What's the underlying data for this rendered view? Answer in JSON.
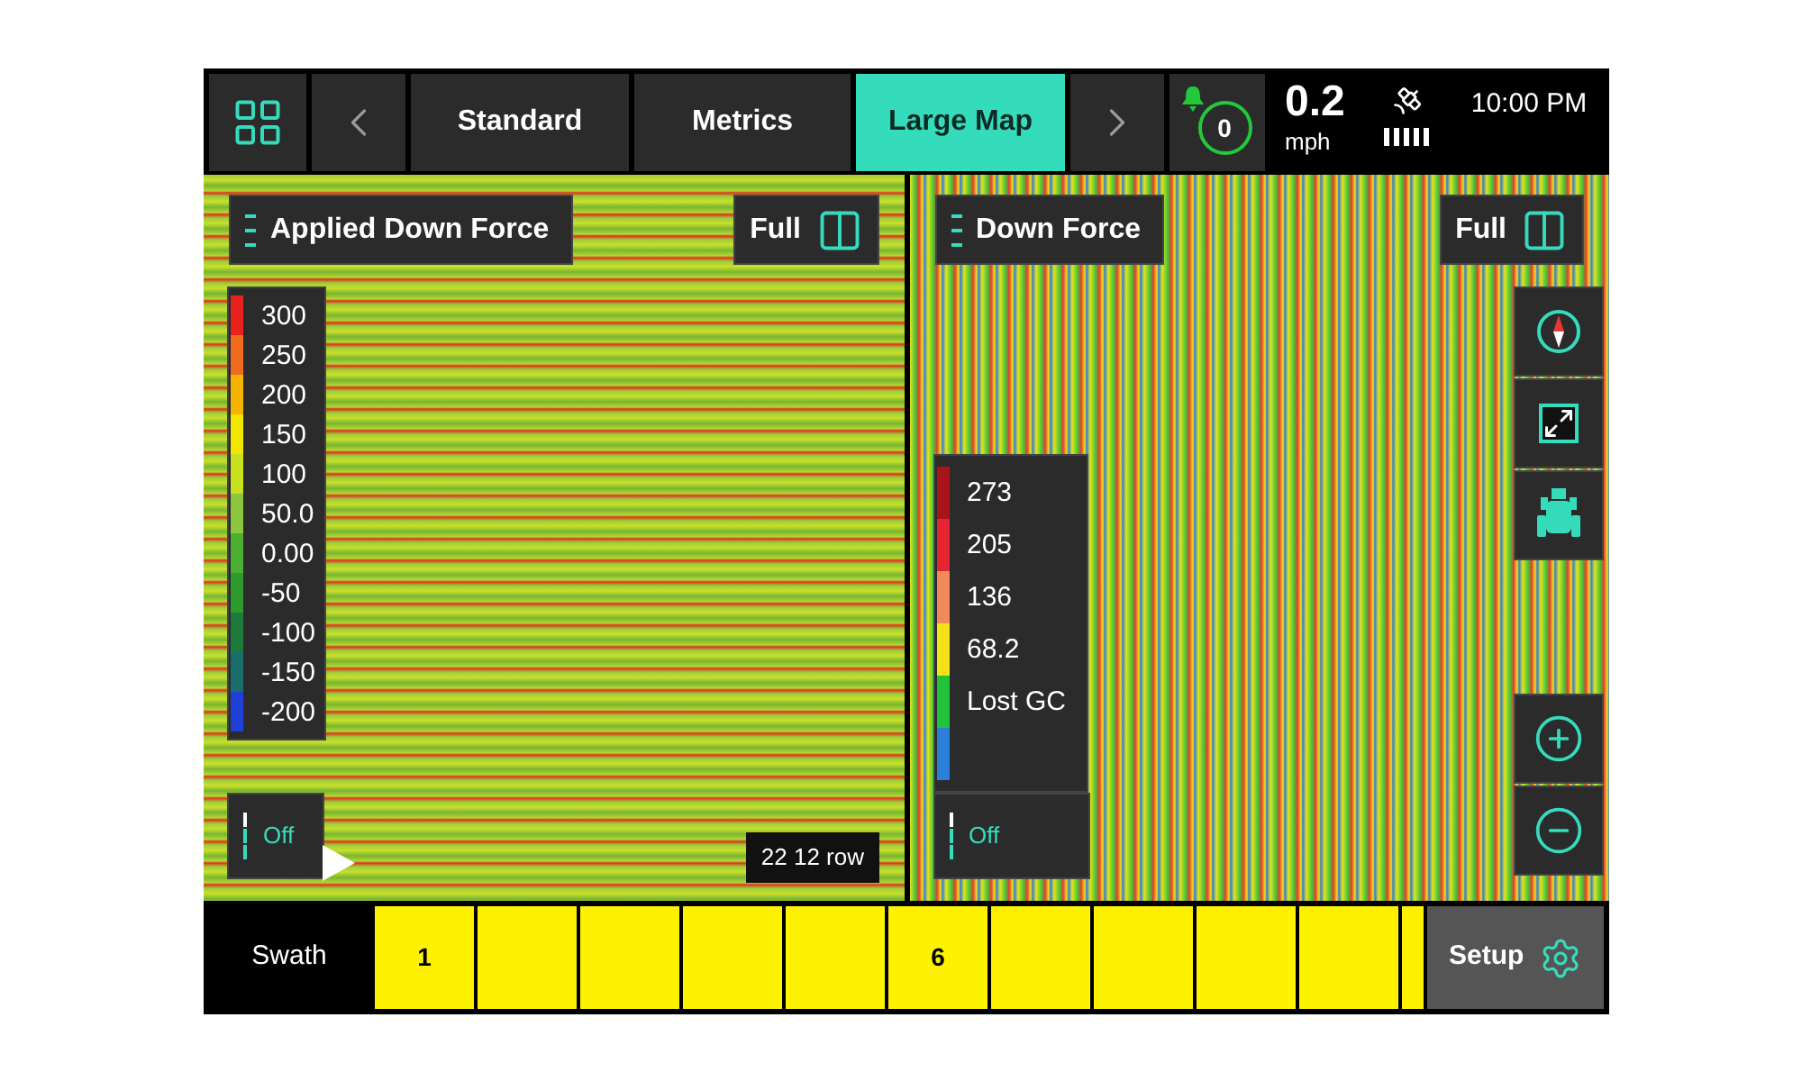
{
  "top_bar": {
    "tabs": [
      {
        "label": "Standard",
        "selected": false
      },
      {
        "label": "Metrics",
        "selected": false
      },
      {
        "label": "Large Map",
        "selected": true
      }
    ],
    "alert_count": "0",
    "speed": {
      "value": "0.2",
      "unit": "mph"
    },
    "time": "10:00 PM"
  },
  "maps": [
    {
      "kind": "smooth",
      "layer": "Applied Down Force",
      "view_button": "Full",
      "legend": [
        {
          "label": "300",
          "color": "#e8231e"
        },
        {
          "label": "250",
          "color": "#f06a1e"
        },
        {
          "label": "200",
          "color": "#f5b400"
        },
        {
          "label": "150",
          "color": "#f2e600"
        },
        {
          "label": "100",
          "color": "#c8e11e"
        },
        {
          "label": "50.0",
          "color": "#8cc63f"
        },
        {
          "label": "0.00",
          "color": "#4caf32"
        },
        {
          "label": "-50",
          "color": "#2e9a2e"
        },
        {
          "label": "-100",
          "color": "#1d7a3a"
        },
        {
          "label": "-150",
          "color": "#1a6e6a"
        },
        {
          "label": "-200",
          "color": "#1f3fd6"
        }
      ],
      "toggle": "Off",
      "tools": false,
      "row_label": "22 12 row"
    },
    {
      "kind": "speckled",
      "layer": "Down Force",
      "view_button": "Full",
      "legend": [
        {
          "label": "273",
          "color": "#a8141a"
        },
        {
          "label": "205",
          "color": "#e52531"
        },
        {
          "label": "136",
          "color": "#f08a5a"
        },
        {
          "label": "68.2",
          "color": "#f5e11a"
        },
        {
          "label": "Lost GC",
          "color": "#22c33a"
        },
        {
          "color": "#2a7fd8"
        }
      ],
      "toggle": "Off",
      "tools": true
    }
  ],
  "bottom_bar": {
    "swath_label": "Swath",
    "sections": [
      {
        "on": true,
        "label": "1"
      },
      {
        "on": true
      },
      {
        "on": true
      },
      {
        "on": true
      },
      {
        "on": true
      },
      {
        "on": true,
        "label": "6"
      },
      {
        "on": true
      },
      {
        "on": true
      },
      {
        "on": true
      },
      {
        "on": true
      },
      {
        "on": true,
        "kind": "partial"
      }
    ],
    "setup": "Setup"
  }
}
